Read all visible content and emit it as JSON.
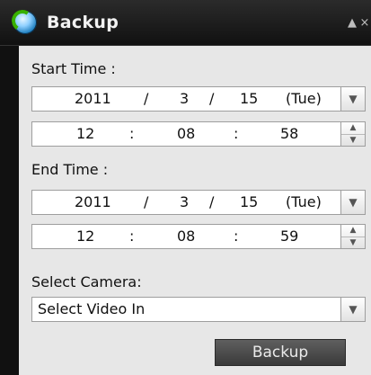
{
  "window": {
    "title": "Backup",
    "minimize_label": "▲",
    "close_label": "×"
  },
  "start": {
    "label": "Start Time :",
    "date": {
      "year": "2011",
      "sep1": "/",
      "month": "3",
      "sep2": "/",
      "day": "15",
      "weekday": "(Tue)"
    },
    "time": {
      "hour": "12",
      "colon1": ":",
      "minute": "08",
      "colon2": ":",
      "second": "58"
    }
  },
  "end": {
    "label": "End Time :",
    "date": {
      "year": "2011",
      "sep1": "/",
      "month": "3",
      "sep2": "/",
      "day": "15",
      "weekday": "(Tue)"
    },
    "time": {
      "hour": "12",
      "colon1": ":",
      "minute": "08",
      "colon2": ":",
      "second": "59"
    }
  },
  "camera": {
    "label": "Select Camera:",
    "selected": "Select Video In"
  },
  "actions": {
    "backup_label": "Backup"
  },
  "icons": {
    "dropdown": "▼",
    "up": "▲",
    "down": "▼"
  }
}
